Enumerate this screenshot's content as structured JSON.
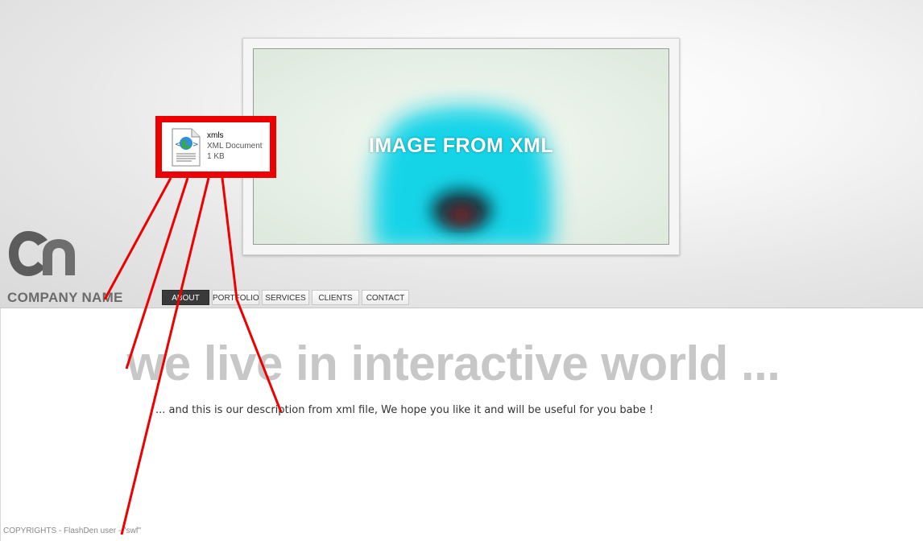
{
  "hero": {
    "image_caption": "IMAGE FROM XML"
  },
  "brand": {
    "company_name": "COMPANY NAME",
    "logo_icon": "cn-logo-icon"
  },
  "nav": {
    "items": [
      {
        "label": "ABOUT",
        "active": true
      },
      {
        "label": "PORTFOLIO",
        "active": false
      },
      {
        "label": "SERVICES",
        "active": false
      },
      {
        "label": "CLIENTS",
        "active": false
      },
      {
        "label": "CONTACT",
        "active": false
      }
    ]
  },
  "content": {
    "headline": "we live in interactive world ...",
    "description": "... and this is our description from xml file, We hope you like it and will be useful for you babe !"
  },
  "footer": {
    "copyright": "COPYRIGHTS - FlashDen user - \"swf\""
  },
  "annotation": {
    "file_name": "xmls",
    "file_type": "XML Document",
    "file_size": "1 KB",
    "file_icon": "xml-document-icon",
    "callout_color": "#ee0000"
  },
  "colors": {
    "headline": "#c7c7c7",
    "active_nav": "#3a3a3a",
    "hero_cyan": "#16d4e8"
  }
}
